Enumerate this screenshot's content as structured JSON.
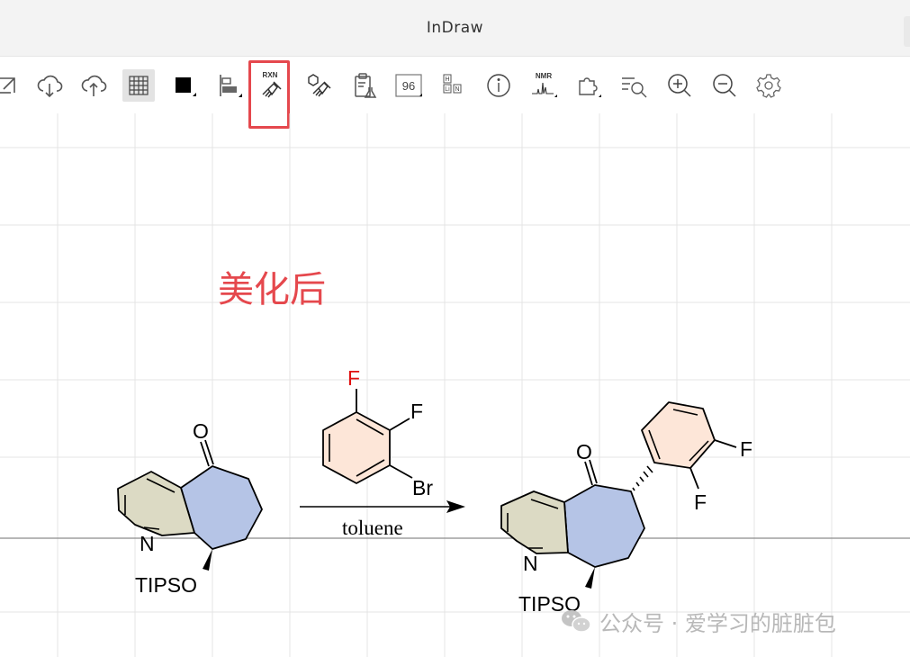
{
  "window": {
    "title": "InDraw"
  },
  "toolbar": {
    "items": [
      {
        "name": "export",
        "icon": "export-icon"
      },
      {
        "name": "cloud-download",
        "icon": "cloud-download-icon"
      },
      {
        "name": "cloud-upload",
        "icon": "cloud-upload-icon"
      },
      {
        "name": "grid",
        "icon": "grid-icon",
        "active": true
      },
      {
        "name": "color",
        "icon": "color-swatch-icon"
      },
      {
        "name": "align",
        "icon": "align-icon"
      },
      {
        "name": "reaction-clean",
        "icon": "rxn-broom-icon",
        "label": "RXN",
        "highlighted": true
      },
      {
        "name": "structure-clean",
        "icon": "molecule-broom-icon"
      },
      {
        "name": "clipboard",
        "icon": "clipboard-flask-icon"
      },
      {
        "name": "96-well",
        "icon": "well-plate-icon",
        "label": "96"
      },
      {
        "name": "periodic-table",
        "icon": "periodic-table-icon",
        "labels": [
          "H",
          "Li",
          "N"
        ]
      },
      {
        "name": "info",
        "icon": "info-icon"
      },
      {
        "name": "nmr",
        "icon": "nmr-icon",
        "label": "NMR"
      },
      {
        "name": "templates",
        "icon": "puzzle-icon"
      },
      {
        "name": "search",
        "icon": "search-list-icon"
      },
      {
        "name": "zoom-in",
        "icon": "zoom-in-icon"
      },
      {
        "name": "zoom-out",
        "icon": "zoom-out-icon"
      },
      {
        "name": "settings",
        "icon": "gear-icon"
      }
    ]
  },
  "canvas": {
    "annotation": "美化后",
    "annotation_color": "#e5484d",
    "reactant": {
      "atoms": {
        "oxygen": "O",
        "nitrogen": "N",
        "protecting_group": "TIPSO"
      }
    },
    "reagent": {
      "atoms": {
        "f1": "F",
        "f2": "F",
        "br": "Br"
      }
    },
    "arrow": {
      "condition": "toluene"
    },
    "product": {
      "atoms": {
        "oxygen": "O",
        "nitrogen": "N",
        "protecting_group": "TIPSO",
        "f1": "F",
        "f2": "F"
      }
    },
    "colors": {
      "pyridine_fill": "#dcdac4",
      "cycloheptane_fill": "#b5c4e6",
      "benzene_fill": "#fde6d8",
      "red_fluorine": "#e01010"
    }
  },
  "watermark": {
    "text": "公众号 · 爱学习的脏脏包"
  }
}
